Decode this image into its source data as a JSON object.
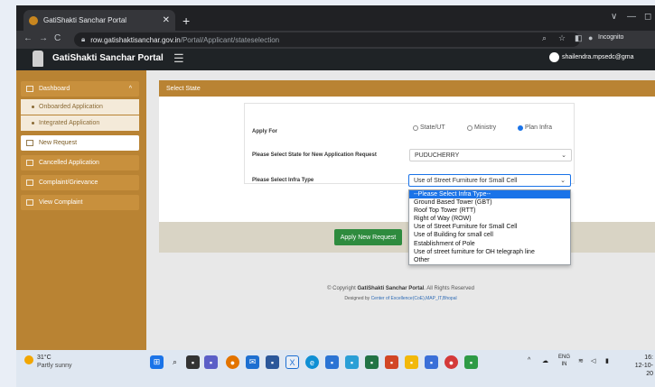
{
  "browser": {
    "tab_title": "GatiShakti Sanchar Portal",
    "tab_close": "✕",
    "new_tab": "+",
    "nav_back": "←",
    "nav_forward": "→",
    "nav_reload": "C",
    "url_host": "row.gatishaktisanchar.gov.in",
    "url_path": "/Portal/Applicant/stateselection",
    "profile_label": "Incognito",
    "win_min": "—",
    "win_max": "◻",
    "win_chevron": "∨"
  },
  "header": {
    "brand": "GatiShakti Sanchar Portal",
    "menu_icon": "☰",
    "user": "shailendra.mpsedc@gma"
  },
  "sidebar": {
    "items": [
      {
        "label": "Dashboard",
        "chevron": "^"
      },
      {
        "label": "Onboarded Application"
      },
      {
        "label": "Integrated Application"
      },
      {
        "label": "New Request"
      },
      {
        "label": "Cancelled Application"
      },
      {
        "label": "Complaint/Grievance"
      },
      {
        "label": "View Complaint"
      }
    ]
  },
  "main": {
    "section_title": "Select State",
    "apply_for_label": "Apply For",
    "radio_options": [
      {
        "label": "State/UT",
        "selected": false
      },
      {
        "label": "Ministry",
        "selected": false
      },
      {
        "label": "Plan Infra",
        "selected": true
      }
    ],
    "state_label": "Please Select State for New Application Request",
    "state_value": "PUDUCHERRY",
    "infra_label": "Please Select Infra Type",
    "infra_value": "Use of Street Furniture for Small Cell",
    "infra_options": [
      "--Please Select Infra Type--",
      "Ground Based Tower (GBT)",
      "Roof Top Tower (RTT)",
      "Right of Way (ROW)",
      "Use of Street Furniture for Small Cell",
      "Use of Building for small cell",
      "Establishment of Pole",
      "Use of street furniture for OH telegraph line",
      "Other"
    ],
    "highlighted_option_index": 0,
    "apply_button": "Apply New Request",
    "footer_copyright_prefix": "© Copyright ",
    "footer_copyright_brand": "GatiShakti Sanchar Portal",
    "footer_copyright_suffix": ". All Rights Reserved",
    "footer_designed_prefix": "Designed by ",
    "footer_designed_link": "Center of Excellence(CoE),MAP_IT,Bhopal"
  },
  "taskbar": {
    "temperature": "31°C",
    "weather": "Partly sunny",
    "lang": "ENG",
    "region": "IN",
    "time": "16:",
    "date": "12-10-20",
    "tray_chevron": "^",
    "app_icons": [
      "windows-start",
      "search",
      "task-view",
      "chat",
      "chrome",
      "mail",
      "store",
      "excel",
      "edge",
      "word",
      "photos",
      "spotify",
      "powerpoint",
      "files",
      "notepad",
      "app2",
      "app3"
    ]
  },
  "colors": {
    "brand_gold": "#b98333",
    "header_dark": "#1f2326",
    "apply_green": "#2e8b3e",
    "select_blue": "#1a73e8"
  }
}
